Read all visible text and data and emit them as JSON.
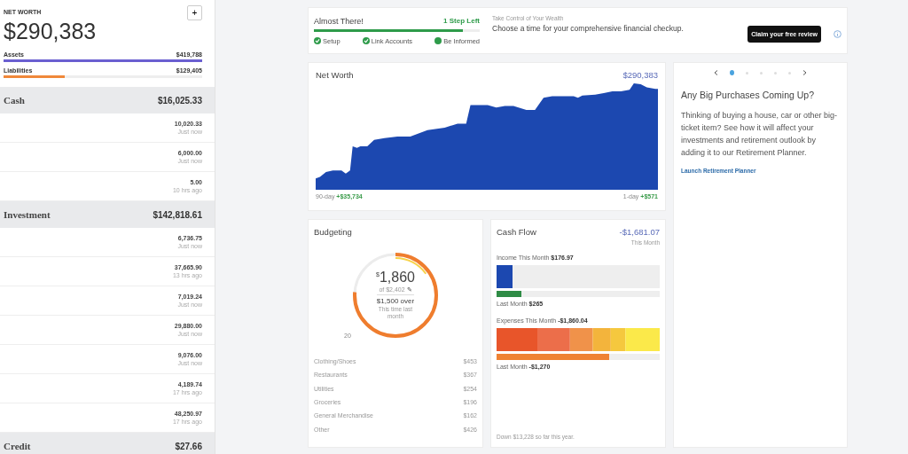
{
  "sidebar": {
    "title": "NET WORTH",
    "add_button": "+",
    "total": "$290,383",
    "summary": [
      {
        "label": "Assets",
        "value": "$419,788",
        "level": 1,
        "color": "#6a5fd0"
      },
      {
        "label": "Liabilities",
        "value": "$129,405",
        "level": 0.31,
        "color": "#f0883a"
      }
    ],
    "groups": [
      {
        "name": "Cash",
        "total": "$16,025.33",
        "accounts": [
          {
            "amount": "10,020.33",
            "updated": "Just now"
          },
          {
            "amount": "6,000.00",
            "updated": "Just now"
          },
          {
            "amount": "5.00",
            "updated": "10 hrs ago"
          }
        ]
      },
      {
        "name": "Investment",
        "total": "$142,818.61",
        "accounts": [
          {
            "amount": "6,736.75",
            "updated": "Just now"
          },
          {
            "amount": "37,665.90",
            "updated": "13 hrs ago"
          },
          {
            "amount": "7,019.24",
            "updated": "Just now"
          },
          {
            "amount": "29,880.00",
            "updated": "Just now"
          },
          {
            "amount": "9,076.00",
            "updated": "Just now"
          },
          {
            "amount": "4,189.74",
            "updated": "17 hrs ago"
          },
          {
            "amount": "48,250.97",
            "updated": "17 hrs ago"
          }
        ]
      },
      {
        "name": "Credit",
        "total": "$27.66"
      }
    ]
  },
  "progress": {
    "title": "Almost There!",
    "steps_left": "1 Step Left",
    "level": 0.9,
    "steps": [
      {
        "label": "Setup",
        "done": true
      },
      {
        "label": "Link Accounts",
        "done": true
      },
      {
        "label": "Be Informed",
        "done": false
      }
    ],
    "eyebrow": "Take Control of Your Wealth",
    "message": "Choose a time for your comprehensive financial checkup.",
    "button": "Claim your free review"
  },
  "net_worth": {
    "title": "Net Worth",
    "value": "$290,383",
    "left_label": "90-day",
    "left_change": "+$35,734",
    "right_label": "1-day",
    "right_change": "+$571"
  },
  "carousel": {
    "dots": [
      {
        "selected": true
      },
      {
        "selected": false
      },
      {
        "selected": false
      },
      {
        "selected": false
      },
      {
        "selected": false
      }
    ],
    "title": "Any Big Purchases Coming Up?",
    "body": "Thinking of buying a house, car or other big-ticket item? See how it will affect your investments and retirement outlook by adding it to our Retirement Planner.",
    "link": "Launch Retirement Planner"
  },
  "budgeting": {
    "title": "Budgeting",
    "currency": "$",
    "amount": "1,860",
    "of": "of $2,402",
    "edit_icon": "✎",
    "over": "$1,500 over",
    "note": "This time last month",
    "day": "20",
    "categories": [
      {
        "name": "Clothing/Shoes",
        "amount": "$453"
      },
      {
        "name": "Restaurants",
        "amount": "$367"
      },
      {
        "name": "Utilities",
        "amount": "$254"
      },
      {
        "name": "Groceries",
        "amount": "$196"
      },
      {
        "name": "General Merchandise",
        "amount": "$162"
      },
      {
        "name": "Other",
        "amount": "$426"
      }
    ]
  },
  "cash_flow": {
    "title": "Cash Flow",
    "value": "-$1,681.07",
    "period": "This Month",
    "income": {
      "label": "Income This Month",
      "value": "$176.97",
      "level": 0.1
    },
    "income_last": {
      "label": "Last Month",
      "value": "$265",
      "level": 0.15
    },
    "expenses_label": "Expenses This Month",
    "expenses_value": "-$1,860.04",
    "expenses_last": {
      "label": "Last Month",
      "value": "-$1,270",
      "level": 0.69
    },
    "footer": "Down $13,228 so far this year."
  }
}
